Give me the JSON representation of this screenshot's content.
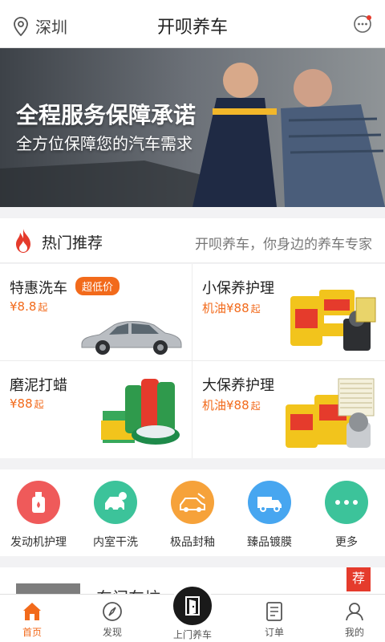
{
  "header": {
    "city": "深圳",
    "title": "开呗养车"
  },
  "banner": {
    "title": "全程服务保障承诺",
    "subtitle": "全方位保障您的汽车需求"
  },
  "hot": {
    "title": "热门推荐",
    "slogan": "开呗养车，你身边的养车专家",
    "items": [
      {
        "title": "特惠洗车",
        "badge": "超低价",
        "price_prefix": "",
        "price": "¥8.8",
        "unit": "起"
      },
      {
        "title": "小保养护理",
        "price_prefix": "机油",
        "price": "¥88",
        "unit": "起"
      },
      {
        "title": "磨泥打蜡",
        "price_prefix": "",
        "price": "¥88",
        "unit": "起"
      },
      {
        "title": "大保养护理",
        "price_prefix": "机油",
        "price": "¥88",
        "unit": "起"
      }
    ]
  },
  "services": [
    {
      "label": "发动机护理",
      "color": "#ef5a5a"
    },
    {
      "label": "内室干洗",
      "color": "#3cc39a"
    },
    {
      "label": "极品封釉",
      "color": "#f6a23a"
    },
    {
      "label": "臻品镀膜",
      "color": "#47a6f0"
    },
    {
      "label": "更多",
      "color": "#3cc39a"
    }
  ],
  "article": {
    "text": "东门车坊",
    "tag": "荐"
  },
  "tabbar": {
    "items": [
      "首页",
      "发现",
      "上门养车",
      "订单",
      "我的"
    ],
    "accent": "#f26a1b"
  }
}
